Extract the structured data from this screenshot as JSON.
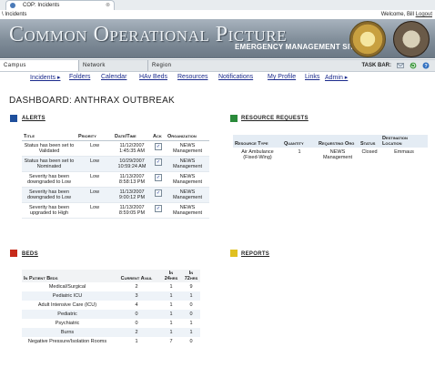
{
  "browser": {
    "tab_title": "COP: Incidents",
    "address": "\\ Incidents",
    "welcome": "Welcome, Bill",
    "logout": "Logout"
  },
  "banner": {
    "title": "Common Operational Picture",
    "subtitle": "EMERGENCY MANAGEMENT SITE"
  },
  "navbar": {
    "items": [
      "Campus",
      "Network",
      "Region"
    ],
    "taskbar_label": "TASK BAR:"
  },
  "menu": {
    "items": [
      "Incidents ▸",
      "Folders",
      "Calendar",
      "HAv Beds",
      "Resources",
      "Notifications",
      "My Profile",
      "Links",
      "Admin ▸"
    ]
  },
  "dashboard": {
    "title": "DASHBOARD: ANTHRAX OUTBREAK"
  },
  "alerts": {
    "title": "ALERTS",
    "columns": [
      "Title",
      "Priority",
      "Date/Time",
      "Ack",
      "Organization"
    ],
    "rows": [
      {
        "title": "Status has been set to Validated",
        "priority": "Low",
        "datetime": "11/12/2007 1:45:35 AM",
        "ack": true,
        "org": "NEWS Management"
      },
      {
        "title": "Status has been set to Nominated",
        "priority": "Low",
        "datetime": "10/29/2007 10:59:24 AM",
        "ack": true,
        "org": "NEWS Management"
      },
      {
        "title": "Severity has been downgraded to Low",
        "priority": "Low",
        "datetime": "11/13/2007 8:58:13 PM",
        "ack": true,
        "org": "NEWS Management"
      },
      {
        "title": "Severity has been downgraded to Low",
        "priority": "Low",
        "datetime": "11/13/2007 9:00:12 PM",
        "ack": true,
        "org": "NEWS Management"
      },
      {
        "title": "Severity has been upgraded to High",
        "priority": "Low",
        "datetime": "11/13/2007 8:59:05 PM",
        "ack": true,
        "org": "NEWS Management"
      }
    ]
  },
  "resource_requests": {
    "title": "RESOURCE REQUESTS",
    "columns": [
      "Resource Type",
      "Quantity",
      "Requesting Org",
      "Status",
      "Destination Location"
    ],
    "rows": [
      {
        "type": "Air Ambulance (Fixed-Wing)",
        "quantity": "1",
        "org": "NEWS Management",
        "status": "Closed",
        "destination": "Emmaus"
      }
    ]
  },
  "beds": {
    "title": "BEDS",
    "columns": [
      "In Patient Beds",
      "Current Avail",
      "In 24hrs",
      "In 72hrs"
    ],
    "rows": [
      {
        "name": "Medical/Surgical",
        "avail": "2",
        "h24": "1",
        "h72": "9"
      },
      {
        "name": "Pediatric ICU",
        "avail": "3",
        "h24": "1",
        "h72": "1"
      },
      {
        "name": "Adult Intensive Care (ICU)",
        "avail": "4",
        "h24": "1",
        "h72": "0"
      },
      {
        "name": "Pediatric",
        "avail": "0",
        "h24": "1",
        "h72": "0"
      },
      {
        "name": "Psychiatric",
        "avail": "0",
        "h24": "1",
        "h72": "1"
      },
      {
        "name": "Burns",
        "avail": "2",
        "h24": "1",
        "h72": "1"
      },
      {
        "name": "Negative Pressure/Isolation Rooms",
        "avail": "1",
        "h24": "7",
        "h72": "0"
      }
    ]
  },
  "reports": {
    "title": "REPORTS"
  },
  "colors": {
    "alerts_icon": "#1f4f9c",
    "resources_icon": "#2a8a3a",
    "beds_icon": "#c62a1a",
    "reports_icon": "#e0c020",
    "link": "#1a2a8c"
  }
}
